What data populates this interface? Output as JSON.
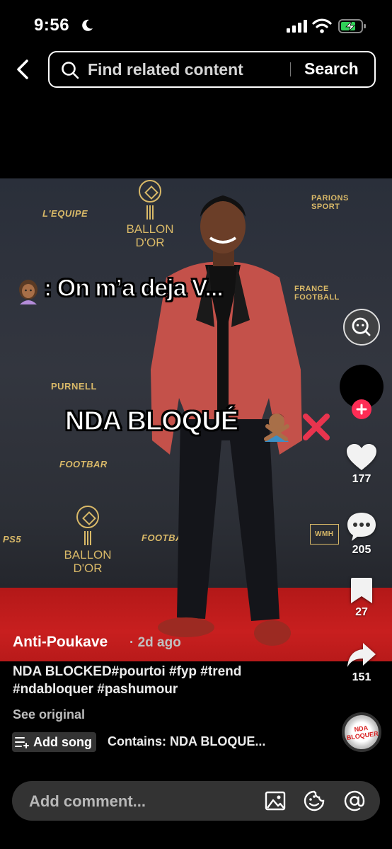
{
  "status_bar": {
    "time": "9:56"
  },
  "search": {
    "placeholder": "Find related content",
    "button_label": "Search"
  },
  "video": {
    "overlay_caption_1": ": On m’a deja V...",
    "overlay_caption_2": "NDA BLOQUÉ",
    "backdrop": {
      "lequipe": "L'EQUIPE",
      "parions_sport": "PARIONS SPORT",
      "france_football": "FRANCE FOOTBALL",
      "purnell": "PURNELL",
      "footbar": "FOOTBAR",
      "ballon_dor": "BALLON D'OR",
      "ps5": "PS5",
      "wmh": "WMH"
    }
  },
  "actions": {
    "likes": "177",
    "comments": "205",
    "saves": "27",
    "shares": "151"
  },
  "post": {
    "author": "Anti-Poukave",
    "time_ago": "· 2d ago",
    "description": "NDA BLOCKED#pourtoi #fyp #trend #ndabloquer #pashumour",
    "see_original": "See original",
    "add_song": "Add song",
    "contains": "Contains: NDA BLOQUE...",
    "disc_label": "NDA BLOQUER"
  },
  "comment_bar": {
    "placeholder": "Add comment..."
  },
  "colors": {
    "accent": "#fe2c55",
    "background": "#000000",
    "carpet": "#c81f1f",
    "gold": "#d9b968"
  }
}
